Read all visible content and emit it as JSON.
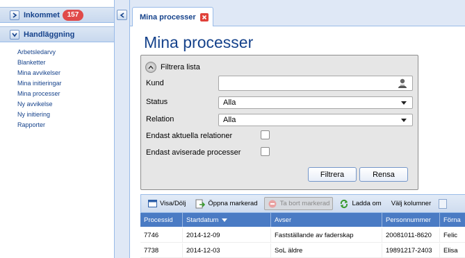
{
  "sidebar": {
    "sections": [
      {
        "title": "Inkommet",
        "badge": "157"
      },
      {
        "title": "Handläggning"
      }
    ],
    "links": [
      {
        "label": "Arbetsledarvy"
      },
      {
        "label": "Blanketter"
      },
      {
        "label": "Mina avvikelser"
      },
      {
        "label": "Mina initieringar"
      },
      {
        "label": "Mina processer"
      },
      {
        "label": "Ny avvikelse"
      },
      {
        "label": "Ny initiering"
      },
      {
        "label": "Rapporter"
      }
    ]
  },
  "tab": {
    "label": "Mina processer"
  },
  "page": {
    "title": "Mina processer"
  },
  "filter": {
    "title": "Filtrera lista",
    "kund": {
      "label": "Kund",
      "value": ""
    },
    "status": {
      "label": "Status",
      "value": "Alla"
    },
    "relation": {
      "label": "Relation",
      "value": "Alla"
    },
    "endast_relationer": {
      "label": "Endast aktuella relationer",
      "checked": false
    },
    "endast_aviserade": {
      "label": "Endast aviserade processer",
      "checked": false
    },
    "btn_filter": "Filtrera",
    "btn_reset": "Rensa"
  },
  "toolbar": {
    "buttons": [
      {
        "label": "Visa/Dölj",
        "icon": "window-icon",
        "disabled": false
      },
      {
        "label": "Öppna markerad",
        "icon": "open-doc-icon",
        "disabled": false
      },
      {
        "label": "Ta bort markerad",
        "icon": "delete-icon",
        "disabled": true
      },
      {
        "label": "Ladda om",
        "icon": "refresh-icon",
        "disabled": false
      },
      {
        "label": "Välj kolumner",
        "icon": "",
        "disabled": false
      }
    ]
  },
  "grid": {
    "columns": [
      "Processid",
      "Startdatum",
      "Avser",
      "Personnummer",
      "Förna"
    ],
    "sort_column": "Startdatum",
    "rows": [
      [
        "7746",
        "2014-12-09",
        "Fastställande av faderskap",
        "20081011-8620",
        "Felic"
      ],
      [
        "7738",
        "2014-12-03",
        "SoL äldre",
        "19891217-2403",
        "Elisa"
      ]
    ]
  },
  "colors": {
    "accent": "#15428b",
    "header_bg": "#4a7bc4",
    "badge": "#e04a4a"
  }
}
